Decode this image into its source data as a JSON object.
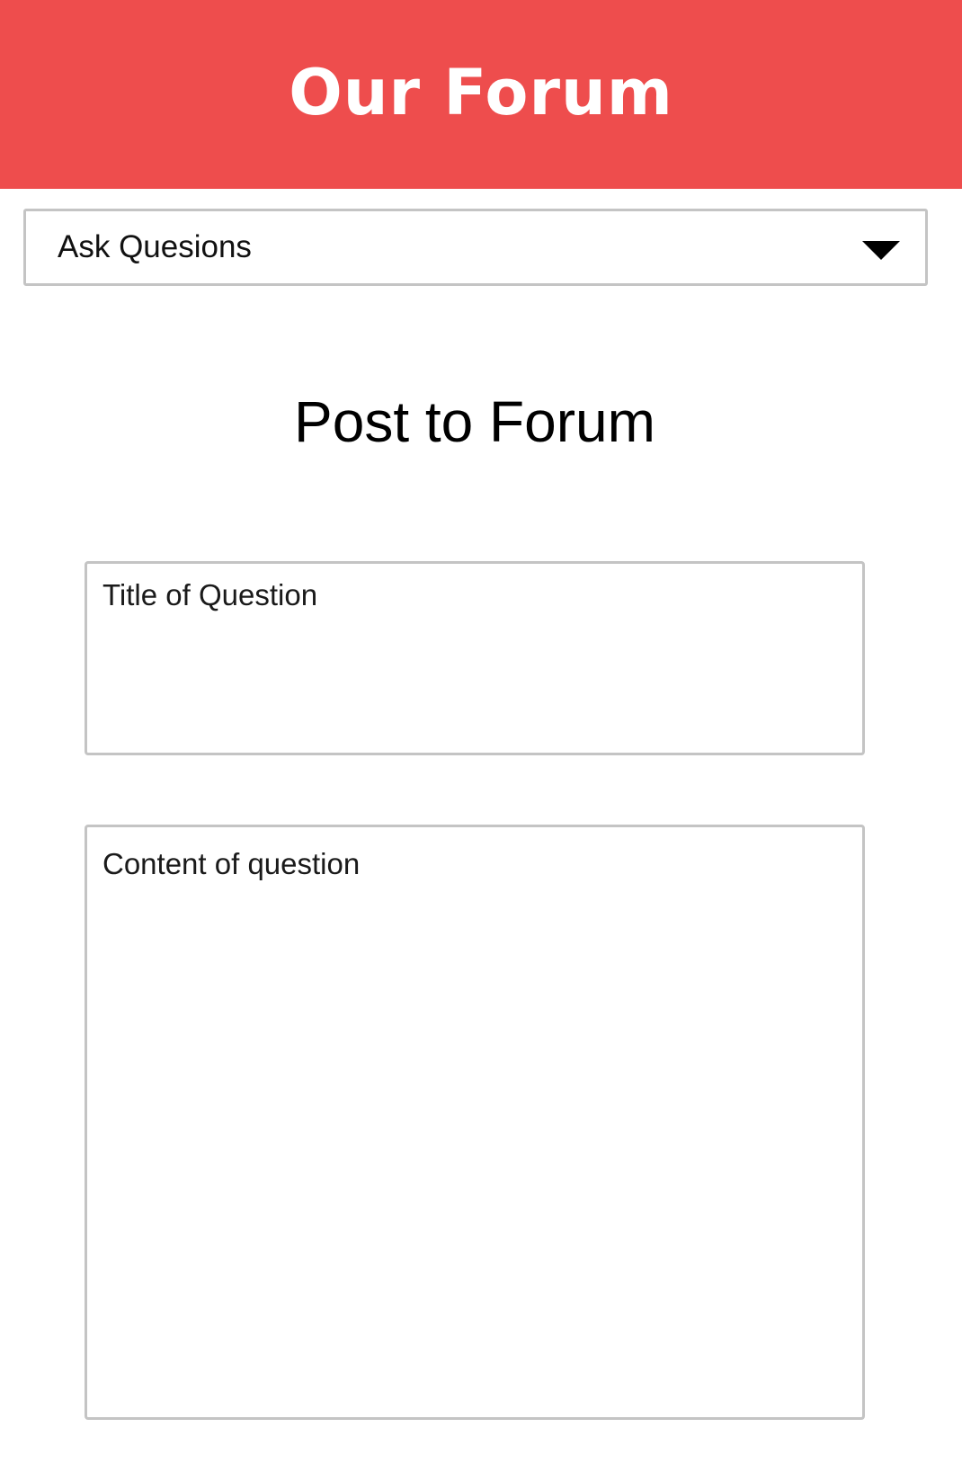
{
  "header": {
    "title": "Our Forum",
    "background_color": "#ee4d4d",
    "text_color": "#ffffff"
  },
  "nav_select": {
    "selected_label": "Ask Quesions",
    "icon": "chevron-down-icon"
  },
  "form": {
    "heading": "Post to Forum",
    "title_field": {
      "placeholder": "Title of Question",
      "value": ""
    },
    "content_field": {
      "placeholder": "Content of question",
      "value": ""
    },
    "border_color": "#c4c4c4"
  }
}
